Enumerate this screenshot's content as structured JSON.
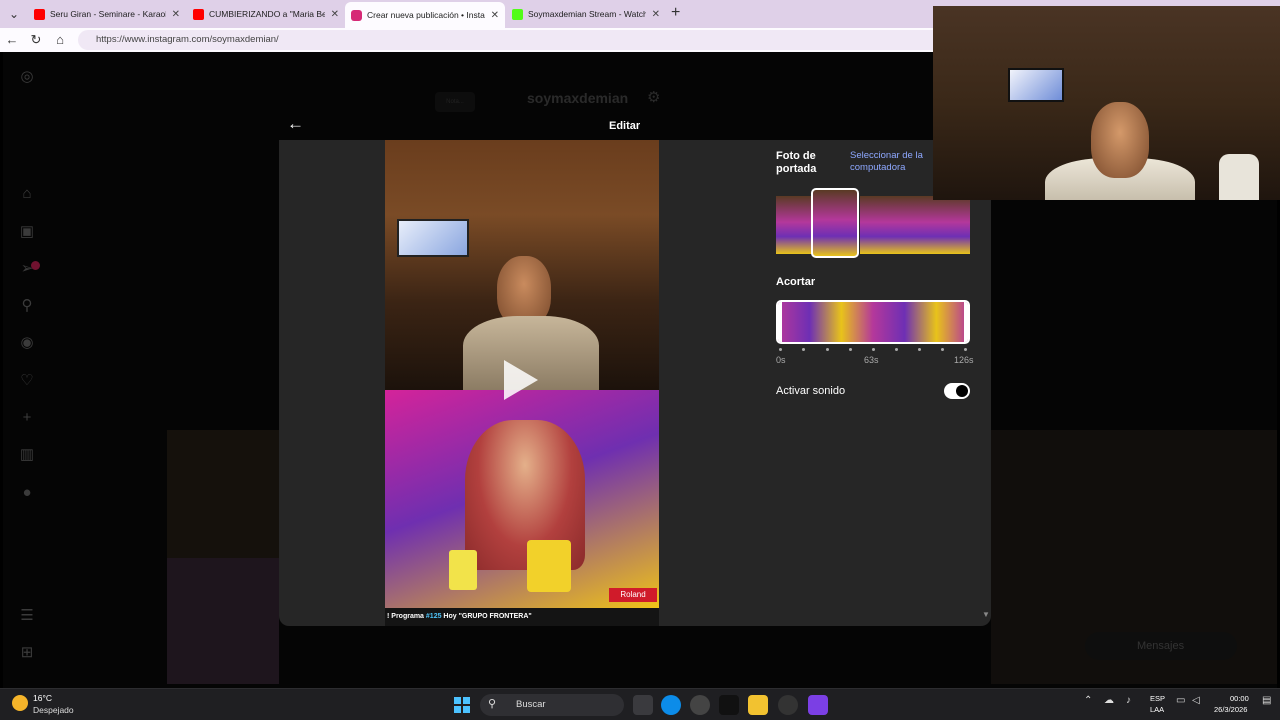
{
  "browser": {
    "tabs": [
      {
        "title": "Seru Giran - Seminare - Karaoke",
        "favicon_color": "#ff0000",
        "active": false
      },
      {
        "title": "CUMBIERIZANDO a \"Maria Becerra\"",
        "favicon_color": "#ff0000",
        "active": false
      },
      {
        "title": "Crear nueva publicación • Instagram",
        "favicon_color": "#d62976",
        "active": true
      },
      {
        "title": "Soymaxdemian Stream - Watch Li...",
        "favicon_color": "#53fc18",
        "active": false
      }
    ],
    "url": "https://www.instagram.com/soymaxdemian/"
  },
  "instagram": {
    "username": "soymaxdemian",
    "note_placeholder": "Nota...",
    "messages_label": "Mensajes",
    "sidebar_icons": [
      "instagram-icon",
      "home-icon",
      "reels-icon",
      "direct-icon",
      "search-icon",
      "explore-icon",
      "heart-icon",
      "create-icon",
      "dashboard-icon",
      "profile-icon",
      "menu-icon",
      "apps-icon"
    ]
  },
  "modal": {
    "title": "Editar",
    "cover_label": "Foto de portada",
    "select_from_computer": "Seleccionar de la computadora",
    "trim_label": "Acortar",
    "trim_ticks": [
      "0s",
      "63s",
      "126s"
    ],
    "sound_label": "Activar sonido",
    "sound_enabled": true,
    "video_ticker_prefix": "! Programa ",
    "video_ticker_number": "#125",
    "video_ticker_suffix": " Hoy \"GRUPO FRONTERA\"",
    "video_brand": "Roland"
  },
  "taskbar": {
    "temperature": "16°C",
    "weather": "Despejado",
    "search_placeholder": "Buscar",
    "lang1": "ESP",
    "lang2": "LAA",
    "time": "00:00",
    "date": "26/3/2026"
  },
  "colors": {
    "modal_bg": "#262626",
    "link": "#8ea8ff",
    "accent_pink": "#d62976"
  }
}
